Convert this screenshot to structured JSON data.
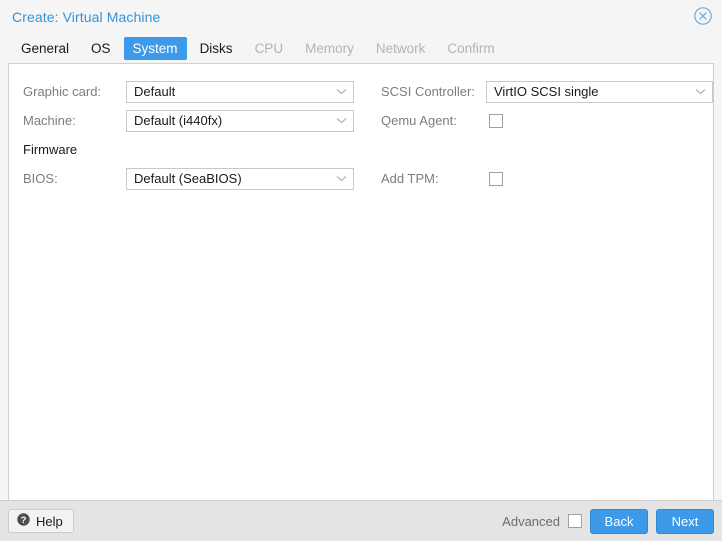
{
  "window": {
    "title": "Create: Virtual Machine",
    "close_icon": "close-circle-icon"
  },
  "tabs": [
    {
      "label": "General",
      "state": "enabled"
    },
    {
      "label": "OS",
      "state": "enabled"
    },
    {
      "label": "System",
      "state": "active"
    },
    {
      "label": "Disks",
      "state": "enabled"
    },
    {
      "label": "CPU",
      "state": "disabled"
    },
    {
      "label": "Memory",
      "state": "disabled"
    },
    {
      "label": "Network",
      "state": "disabled"
    },
    {
      "label": "Confirm",
      "state": "disabled"
    }
  ],
  "form": {
    "left": {
      "graphic_card": {
        "label": "Graphic card:",
        "value": "Default"
      },
      "machine": {
        "label": "Machine:",
        "value": "Default (i440fx)"
      },
      "firmware_heading": "Firmware",
      "bios": {
        "label": "BIOS:",
        "value": "Default (SeaBIOS)"
      }
    },
    "right": {
      "scsi_controller": {
        "label": "SCSI Controller:",
        "value": "VirtIO SCSI single"
      },
      "qemu_agent": {
        "label": "Qemu Agent:",
        "checked": false
      },
      "add_tpm": {
        "label": "Add TPM:",
        "checked": false
      }
    }
  },
  "footer": {
    "help_label": "Help",
    "help_icon": "question-circle-icon",
    "advanced_label": "Advanced",
    "advanced_checked": false,
    "back_label": "Back",
    "next_label": "Next"
  },
  "colors": {
    "accent": "#3c9ae8",
    "title_text": "#3892d4",
    "label_text": "#7d7d7d",
    "disabled_tab": "#b4b4b4",
    "panel_bg": "#ffffff",
    "dialog_bg": "#f5f5f5",
    "footer_bg": "#e4e4e4"
  }
}
